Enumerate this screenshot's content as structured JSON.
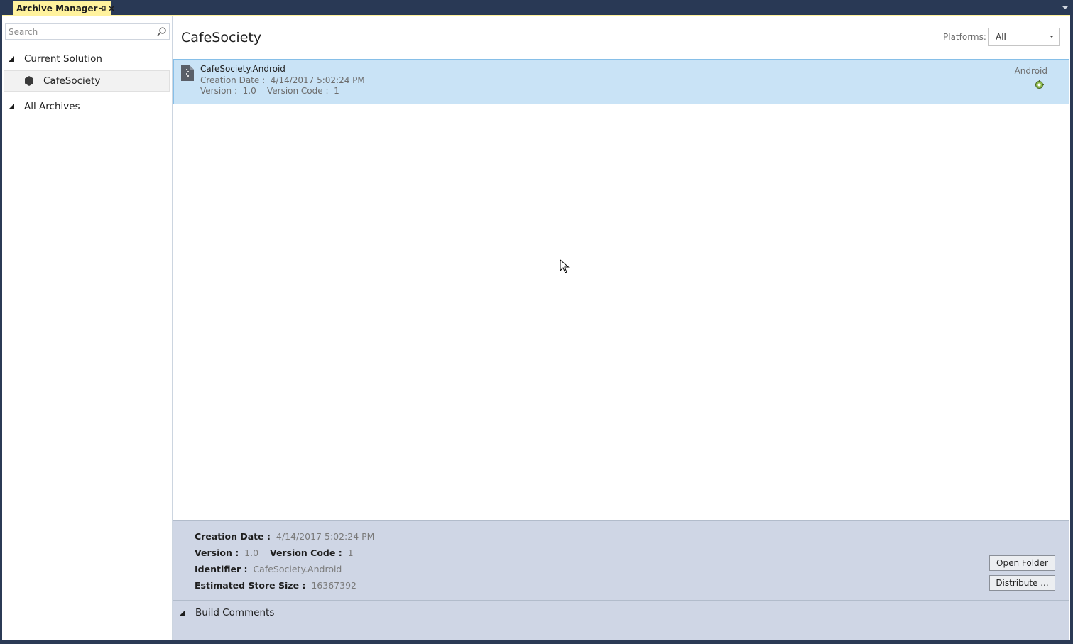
{
  "window": {
    "tab_title": "Archive Manager",
    "pin_icon": "pin-icon",
    "close_icon": "close-icon"
  },
  "sidebar": {
    "search_placeholder": "Search",
    "search_icon": "search-icon",
    "current_solution_label": "Current Solution",
    "solution_item_label": "CafeSociety",
    "solution_item_icon": "hexagon-icon",
    "all_archives_label": "All Archives"
  },
  "header": {
    "title": "CafeSociety",
    "platforms_label": "Platforms:",
    "platforms_value": "All"
  },
  "archives": [
    {
      "name": "CafeSociety.Android",
      "creation_date_label": "Creation Date :",
      "creation_date": "4/14/2017 5:02:24 PM",
      "version_label": "Version :",
      "version": "1.0",
      "version_code_label": "Version Code :",
      "version_code": "1",
      "platform": "Android",
      "platform_icon": "android-icon"
    }
  ],
  "details": {
    "creation_date_label": "Creation Date :",
    "creation_date": "4/14/2017 5:02:24 PM",
    "version_label": "Version :",
    "version": "1.0",
    "version_code_label": "Version Code :",
    "version_code": "1",
    "identifier_label": "Identifier :",
    "identifier": "CafeSociety.Android",
    "store_size_label": "Estimated Store Size :",
    "store_size": "16367392",
    "open_folder_label": "Open Folder",
    "distribute_label": "Distribute ...",
    "build_comments_label": "Build Comments"
  },
  "colors": {
    "title_bar": "#293955",
    "active_tab": "#fff29d",
    "selected_row": "#c9e3f6",
    "details_panel": "#cfd6e5"
  }
}
